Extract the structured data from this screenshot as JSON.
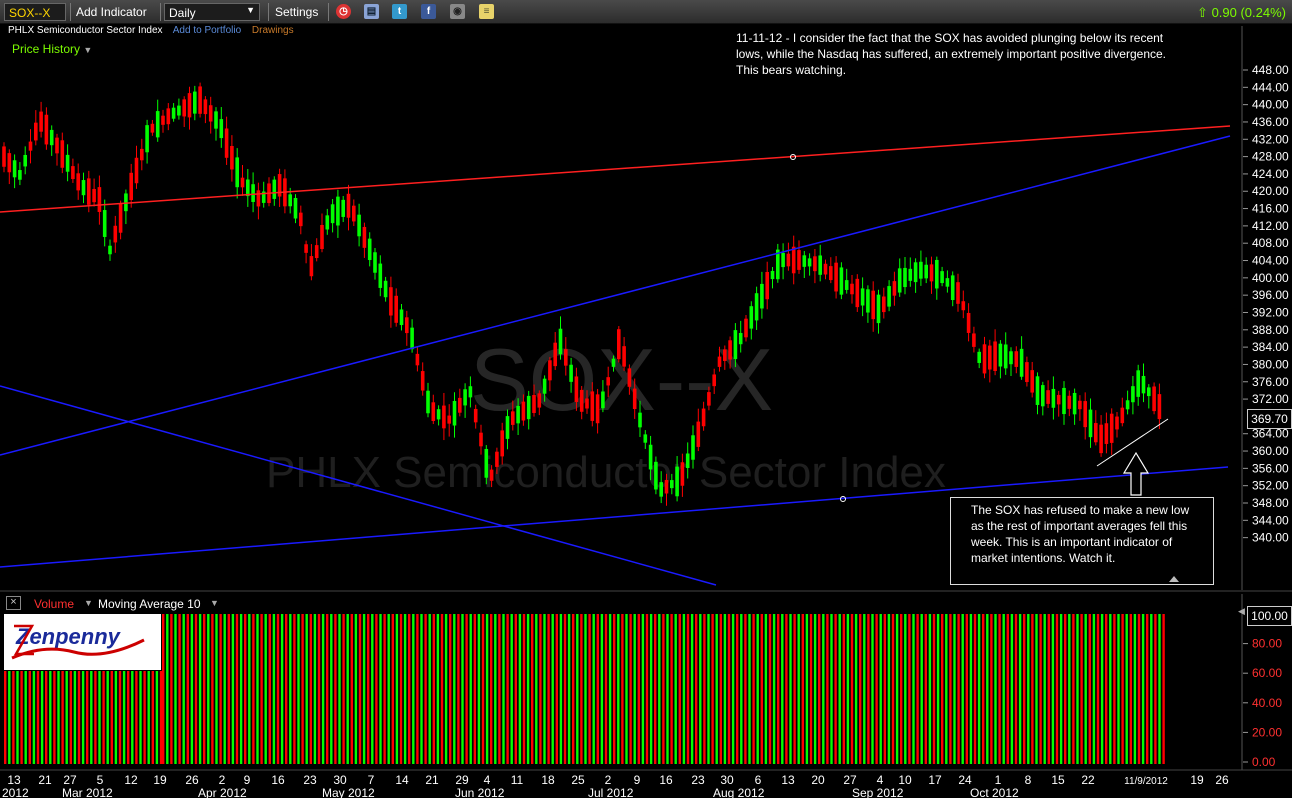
{
  "toolbar": {
    "symbol": "SOX--X",
    "add_indicator": "Add Indicator",
    "interval": "Daily",
    "settings": "Settings",
    "icons": [
      "alarm-clock-icon",
      "print-icon",
      "twitter-icon",
      "facebook-icon",
      "camera-icon",
      "notes-icon"
    ],
    "quote_change": "0.90 (0.24%)"
  },
  "info": {
    "name": "PHLX Semiconductor Sector Index",
    "add_portfolio": "Add to Portfolio",
    "drawings": "Drawings"
  },
  "price_history_label": "Price History",
  "watermark": {
    "symbol": "SOX--X",
    "name": "PHLX Semiconductor Sector Index"
  },
  "comment": "11-11-12 - I consider the fact that the SOX has avoided plunging below its recent lows, while the Nasdaq has suffered, an extremely important positive divergence. This bears watching.",
  "annotation": "The SOX has refused to make a new low as the rest of important averages fell this week. This is an important indicator of market intentions. Watch it.",
  "price_axis": {
    "ticks": [
      "448.00",
      "444.00",
      "440.00",
      "436.00",
      "432.00",
      "428.00",
      "424.00",
      "420.00",
      "416.00",
      "412.00",
      "408.00",
      "404.00",
      "400.00",
      "396.00",
      "392.00",
      "388.00",
      "384.00",
      "380.00",
      "376.00",
      "372.00",
      "364.00",
      "360.00",
      "356.00",
      "352.00",
      "348.00",
      "344.00",
      "340.00"
    ],
    "current": "369.70"
  },
  "volume": {
    "label": "Volume",
    "ma_label": "Moving Average 10",
    "ticks": [
      "100.00",
      "80.00",
      "60.00",
      "40.00",
      "20.00",
      "0.00"
    ],
    "max_label": "100.00"
  },
  "logo_text": "Zenpenny",
  "date_axis": {
    "ticks": [
      "13",
      "21",
      "27",
      "5",
      "12",
      "19",
      "26",
      "2",
      "9",
      "16",
      "23",
      "30",
      "7",
      "14",
      "21",
      "29",
      "4",
      "11",
      "18",
      "25",
      "2",
      "9",
      "16",
      "23",
      "30",
      "6",
      "13",
      "20",
      "27",
      "4",
      "10",
      "17",
      "24",
      "1",
      "8",
      "15",
      "22",
      "11/9/2012",
      "19",
      "26"
    ],
    "months": [
      "2012",
      "Mar 2012",
      "Apr 2012",
      "May 2012",
      "Jun 2012",
      "Jul 2012",
      "Aug 2012",
      "Sep 2012",
      "Oct 2012"
    ]
  },
  "colors": {
    "up": "#00ff00",
    "down": "#ff0000",
    "trend_red": "#ff2020",
    "trend_blue": "#1a1aff",
    "quote": "#7CFC00"
  }
}
